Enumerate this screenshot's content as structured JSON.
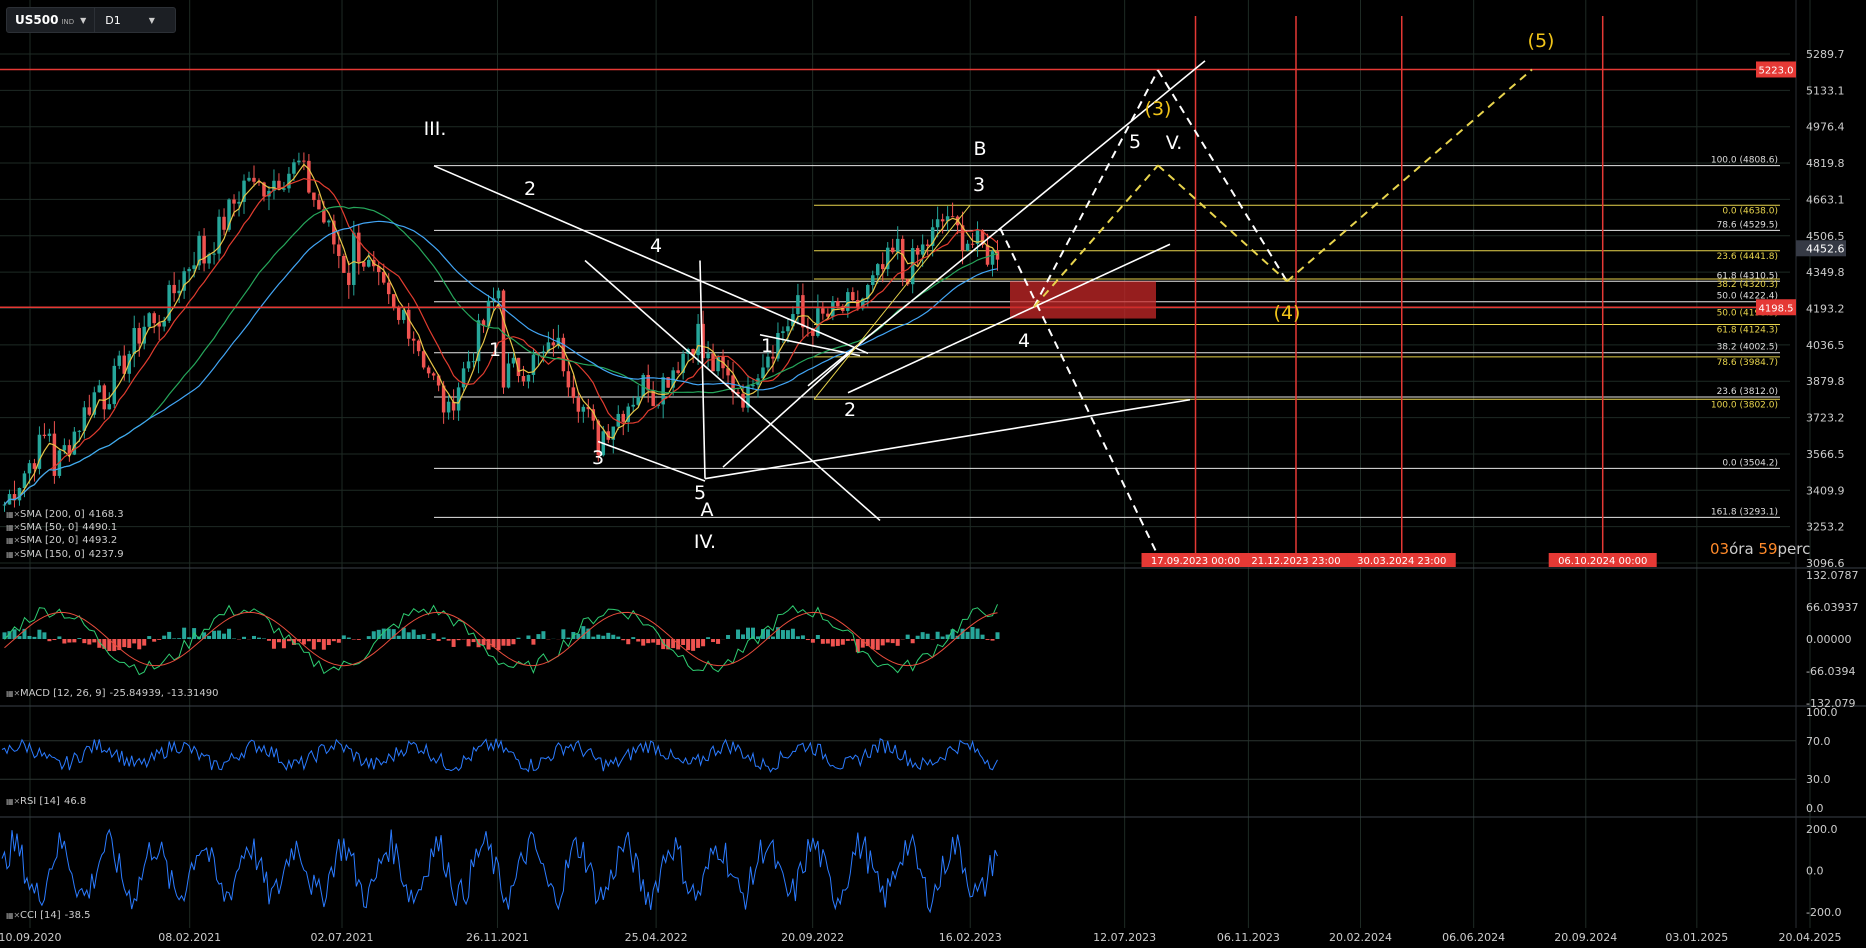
{
  "toolbar": {
    "symbol": "US500",
    "symbol_tag": "IND",
    "timeframe": "D1"
  },
  "price_axis": {
    "main_ticks": [
      "5289.7",
      "5133.1",
      "4976.4",
      "4819.8",
      "4663.1",
      "4506.5",
      "4349.8",
      "4193.2",
      "4036.5",
      "3879.8",
      "3723.2",
      "3566.5",
      "3409.9",
      "3253.2",
      "3096.6"
    ],
    "current_price": "4452.6",
    "hline_label": "5223.0",
    "hline2_label": "4198.5"
  },
  "macd_axis": [
    "132.0787",
    "66.03937",
    "0.00000",
    "-66.0394",
    "-132.079"
  ],
  "rsi_axis": [
    "100.0",
    "70.0",
    "30.0",
    "0.0"
  ],
  "cci_axis": [
    "200.0",
    "0.0",
    "-200.0"
  ],
  "time_axis": [
    "10.09.2020",
    "08.02.2021",
    "02.07.2021",
    "26.11.2021",
    "25.04.2022",
    "20.09.2022",
    "16.02.2023",
    "12.07.2023",
    "06.11.2023",
    "20.02.2024",
    "06.06.2024",
    "20.09.2024",
    "03.01.2025",
    "20.04.2025"
  ],
  "vlines": [
    "17.09.2023 00:00",
    "21.12.2023 23:00",
    "30.03.2024 23:00",
    "06.10.2024 00:00"
  ],
  "fib_white": [
    "100.0 (4808.6)",
    "78.6 (4529.5)",
    "61.8 (4310.5)",
    "50.0 (4222.4)",
    "38.2 (4002.5)",
    "23.6 (3812.0)",
    "0.0 (3504.2)",
    "161.8 (3293.1)"
  ],
  "fib_yellow": [
    "0.0 (4638.0)",
    "23.6 (4441.8)",
    "38.2 (4320.3)",
    "50.0 (4198.5)",
    "61.8 (4124.3)",
    "78.6 (3984.7)",
    "100.0 (3802.0)"
  ],
  "wave_labels": {
    "w": [
      "III.",
      "2",
      "4",
      "1",
      "3",
      "5",
      "A",
      "IV.",
      "1",
      "2",
      "3",
      "B",
      "4",
      "5",
      "V."
    ],
    "y": [
      "(3)",
      "(4)",
      "(5)"
    ]
  },
  "indicators": {
    "sma200": {
      "label": "SMA [200, 0]",
      "value": "4168.3"
    },
    "sma50": {
      "label": "SMA [50, 0]",
      "value": "4490.1"
    },
    "sma20": {
      "label": "SMA [20, 0]",
      "value": "4493.2"
    },
    "sma150": {
      "label": "SMA [150, 0]",
      "value": "4237.9"
    },
    "macd": {
      "label": "MACD [12, 26, 9]",
      "value": "-25.84939,  -13.31490"
    },
    "rsi": {
      "label": "RSI [14]",
      "value": "46.8"
    },
    "cci": {
      "label": "CCI [14]",
      "value": "-38.5"
    }
  },
  "countdown": {
    "hours": "03",
    "hours_unit": "óra",
    "minutes": "59",
    "minutes_unit": "perc"
  },
  "colors": {
    "bg": "#000000",
    "grid": "#1e2a24",
    "up": "#26a69a",
    "down": "#ef5350",
    "accent_red": "#e53935",
    "fib_yellow": "#e8d44d",
    "rsi": "#2b7bff",
    "sma_yellow": "#e8c547",
    "sma_red": "#e03c2f",
    "sma_green": "#26a65b",
    "sma_blue": "#42a5f5"
  }
}
